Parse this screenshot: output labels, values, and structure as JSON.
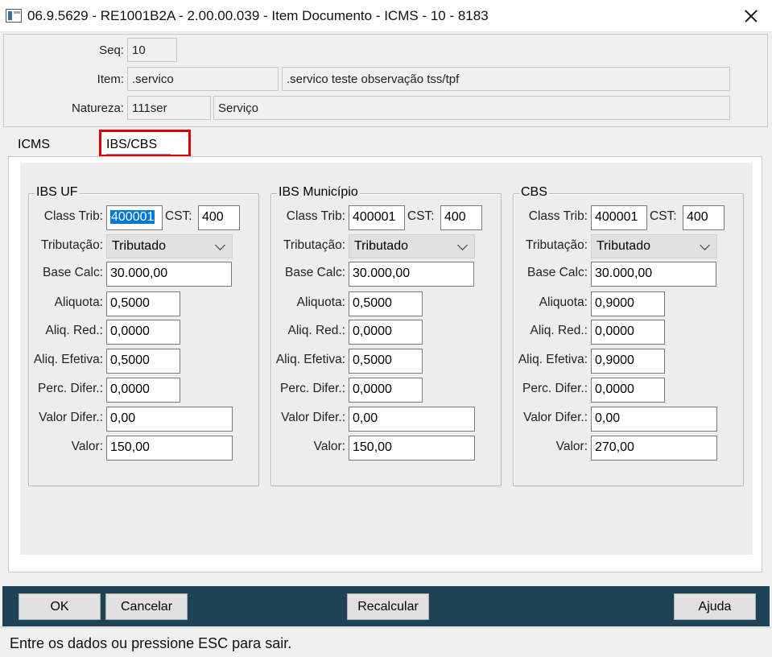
{
  "window": {
    "title": "06.9.5629 - RE1001B2A - 2.00.00.039 - Item Documento - ICMS - 10 - 8183"
  },
  "header": {
    "seq_label": "Seq:",
    "seq_value": "10",
    "item_label": "Item:",
    "item_code": ".servico",
    "item_desc": ".servico teste observação tss/tpf",
    "natureza_label": "Natureza:",
    "natureza_code": "111ser",
    "natureza_desc": "Serviço"
  },
  "tabs": [
    {
      "label": "ICMS"
    },
    {
      "label": "IBS/CBS",
      "active": true
    }
  ],
  "field_labels": {
    "class_trib": "Class Trib:",
    "cst": "CST:",
    "tributacao": "Tributação:",
    "base_calc": "Base Calc:",
    "aliquota": "Aliquota:",
    "aliq_red": "Aliq. Red.:",
    "aliq_efetiva": "Aliq. Efetiva:",
    "perc_difer": "Perc. Difer.:",
    "valor_difer": "Valor Difer.:",
    "valor": "Valor:"
  },
  "groups": [
    {
      "title": "IBS UF",
      "class_trib": "400001",
      "cst": "400",
      "tributacao": "Tributado",
      "base_calc": "30.000,00",
      "aliquota": "0,5000",
      "aliq_red": "0,0000",
      "aliq_efetiva": "0,5000",
      "perc_difer": "0,0000",
      "valor_difer": "0,00",
      "valor": "150,00"
    },
    {
      "title": "IBS Município",
      "class_trib": "400001",
      "cst": "400",
      "tributacao": "Tributado",
      "base_calc": "30.000,00",
      "aliquota": "0,5000",
      "aliq_red": "0,0000",
      "aliq_efetiva": "0,5000",
      "perc_difer": "0,0000",
      "valor_difer": "0,00",
      "valor": "150,00"
    },
    {
      "title": "CBS",
      "class_trib": "400001",
      "cst": "400",
      "tributacao": "Tributado",
      "base_calc": "30.000,00",
      "aliquota": "0,9000",
      "aliq_red": "0,0000",
      "aliq_efetiva": "0,9000",
      "perc_difer": "0,0000",
      "valor_difer": "0,00",
      "valor": "270,00"
    }
  ],
  "buttons": {
    "ok": "OK",
    "cancel": "Cancelar",
    "recalc": "Recalcular",
    "help": "Ajuda"
  },
  "status": {
    "message": "Entre os dados ou pressione ESC para sair."
  },
  "colors": {
    "footer_bg": "#1e4356",
    "highlight_border": "#e00000",
    "selection": "#0078d7"
  },
  "icons": {
    "app": "app-window-icon",
    "close": "close-icon",
    "dropdown": "chevron-down-icon"
  }
}
